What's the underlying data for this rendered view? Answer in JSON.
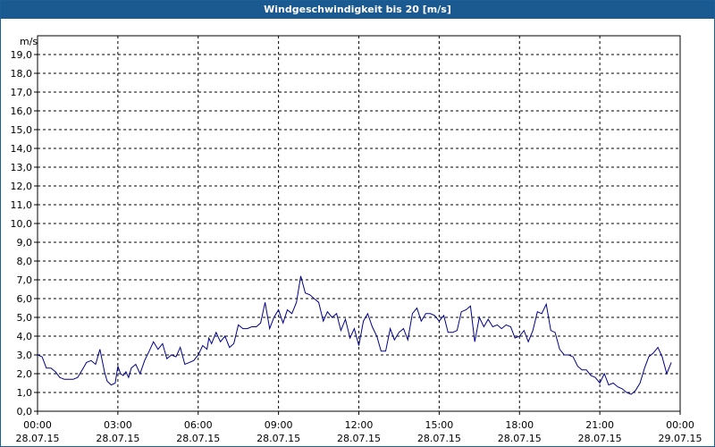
{
  "window": {
    "title": "Windgeschwindigkeit bis 20 [m/s]"
  },
  "colors": {
    "title_bar": "#1a5a90",
    "line": "#00008b",
    "grid": "#000000"
  },
  "chart_data": {
    "type": "line",
    "title": "Windgeschwindigkeit bis 20 [m/s]",
    "ylabel": "m/s",
    "xlabel": "",
    "ylim": [
      0,
      20
    ],
    "xlim_hours": [
      0,
      24
    ],
    "grid": true,
    "grid_style": "dashed",
    "y_ticks": [
      "0,0",
      "1,0",
      "2,0",
      "3,0",
      "4,0",
      "5,0",
      "6,0",
      "7,0",
      "8,0",
      "9,0",
      "10,0",
      "11,0",
      "12,0",
      "13,0",
      "14,0",
      "15,0",
      "16,0",
      "17,0",
      "18,0",
      "19,0"
    ],
    "x_ticks": [
      {
        "time": "00:00",
        "date": "28.07.15",
        "hour": 0
      },
      {
        "time": "03:00",
        "date": "28.07.15",
        "hour": 3
      },
      {
        "time": "06:00",
        "date": "28.07.15",
        "hour": 6
      },
      {
        "time": "09:00",
        "date": "28.07.15",
        "hour": 9
      },
      {
        "time": "12:00",
        "date": "28.07.15",
        "hour": 12
      },
      {
        "time": "15:00",
        "date": "28.07.15",
        "hour": 15
      },
      {
        "time": "18:00",
        "date": "28.07.15",
        "hour": 18
      },
      {
        "time": "21:00",
        "date": "28.07.15",
        "hour": 21
      },
      {
        "time": "00:00",
        "date": "29.07.15",
        "hour": 24
      }
    ],
    "series": [
      {
        "x_hours": [
          0.0,
          0.17,
          0.33,
          0.5,
          0.67,
          0.83,
          1.0,
          1.17,
          1.33,
          1.5,
          1.67,
          1.83,
          2.0,
          2.17,
          2.33,
          2.5,
          2.6,
          2.75,
          2.9,
          3.0,
          3.1,
          3.2,
          3.3,
          3.4,
          3.5,
          3.67,
          3.83,
          4.0,
          4.17,
          4.33,
          4.5,
          4.67,
          4.83,
          5.0,
          5.17,
          5.33,
          5.5,
          5.67,
          5.83,
          6.0,
          6.17,
          6.33,
          6.4,
          6.5,
          6.67,
          6.83,
          7.0,
          7.17,
          7.33,
          7.5,
          7.67,
          7.83,
          8.0,
          8.17,
          8.33,
          8.5,
          8.67,
          8.83,
          9.0,
          9.17,
          9.33,
          9.5,
          9.67,
          9.83,
          10.0,
          10.17,
          10.33,
          10.5,
          10.67,
          10.83,
          11.0,
          11.17,
          11.33,
          11.5,
          11.67,
          11.83,
          12.0,
          12.17,
          12.33,
          12.5,
          12.67,
          12.83,
          13.0,
          13.17,
          13.33,
          13.5,
          13.67,
          13.83,
          14.0,
          14.17,
          14.33,
          14.5,
          14.67,
          14.83,
          15.0,
          15.17,
          15.33,
          15.5,
          15.67,
          15.83,
          16.0,
          16.17,
          16.33,
          16.5,
          16.67,
          16.83,
          17.0,
          17.17,
          17.33,
          17.5,
          17.67,
          17.83,
          18.0,
          18.17,
          18.33,
          18.5,
          18.67,
          18.83,
          19.0,
          19.17,
          19.33,
          19.5,
          19.67,
          19.83,
          20.0,
          20.17,
          20.33,
          20.5,
          20.67,
          20.83,
          21.0,
          21.17,
          21.33,
          21.5,
          21.67,
          21.83,
          22.0,
          22.17,
          22.33,
          22.5,
          22.67,
          22.83,
          23.0,
          23.17,
          23.33,
          23.5,
          23.67
        ],
        "values": [
          3.0,
          2.9,
          2.3,
          2.3,
          2.1,
          1.8,
          1.7,
          1.7,
          1.7,
          1.8,
          2.2,
          2.6,
          2.7,
          2.5,
          3.3,
          2.1,
          1.6,
          1.4,
          1.5,
          2.4,
          2.0,
          1.9,
          2.1,
          1.8,
          2.3,
          2.5,
          2.0,
          2.7,
          3.2,
          3.7,
          3.3,
          3.6,
          2.8,
          3.0,
          2.9,
          3.4,
          2.5,
          2.6,
          2.7,
          3.0,
          3.5,
          3.3,
          3.9,
          3.6,
          4.2,
          3.7,
          4.0,
          3.4,
          3.6,
          4.6,
          4.4,
          4.4,
          4.5,
          4.5,
          4.7,
          5.8,
          4.4,
          5.0,
          5.4,
          4.7,
          5.4,
          5.2,
          5.8,
          7.2,
          6.3,
          6.2,
          6.0,
          5.8,
          4.8,
          5.3,
          5.0,
          5.2,
          4.3,
          4.9,
          3.9,
          4.4,
          3.5,
          4.8,
          5.2,
          4.5,
          4.0,
          3.2,
          3.2,
          4.4,
          3.8,
          4.2,
          4.4,
          3.8,
          5.2,
          5.5,
          4.8,
          5.2,
          5.2,
          5.1,
          4.8,
          5.1,
          4.2,
          4.2,
          4.3,
          5.3,
          5.4,
          5.6,
          3.7,
          5.0,
          4.5,
          4.9,
          4.5,
          4.6,
          4.4,
          4.6,
          4.5,
          3.9,
          4.0,
          4.3,
          3.7,
          4.3,
          5.3,
          5.2,
          5.7,
          4.3,
          4.2,
          3.3,
          3.0,
          3.0,
          2.9,
          2.4,
          2.2,
          2.2,
          1.9,
          1.8,
          1.5,
          2.0,
          1.4,
          1.5,
          1.3,
          1.2,
          1.0,
          0.9,
          1.1,
          1.5,
          2.3,
          2.9,
          3.1,
          3.4,
          2.9,
          2.0,
          2.6,
          2.0,
          1.4
        ]
      }
    ]
  }
}
